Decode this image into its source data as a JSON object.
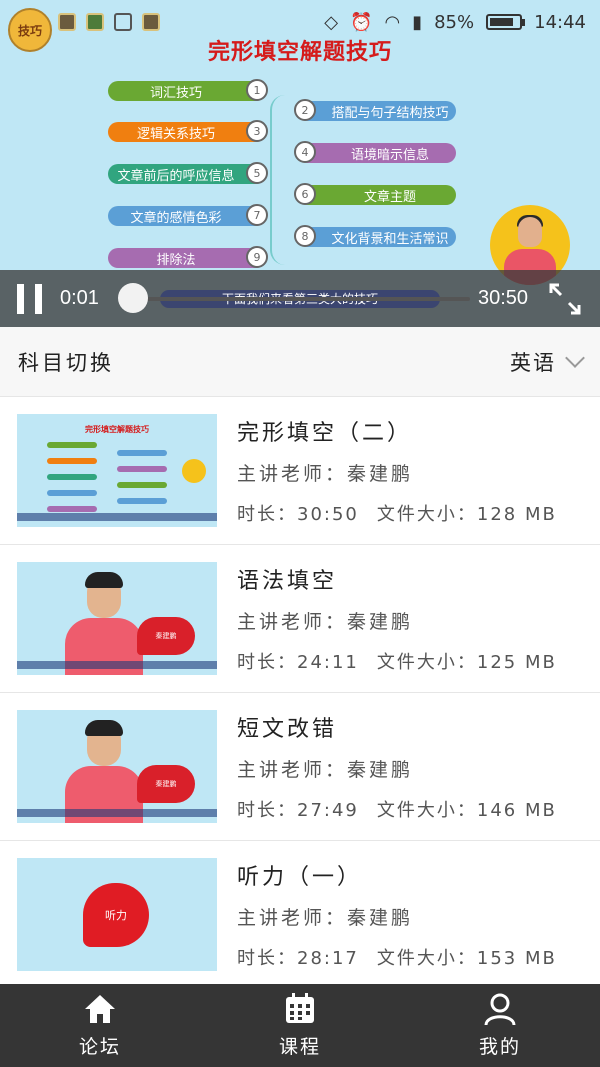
{
  "status_bar": {
    "battery": "85%",
    "battery_level": 0.85,
    "time": "14:44"
  },
  "video": {
    "slide_title": "完形填空解题技巧",
    "logo_text": "技巧",
    "mindmap": [
      {
        "num": "1",
        "label": "词汇技巧",
        "color": "#6aa833"
      },
      {
        "num": "2",
        "label": "搭配与句子结构技巧",
        "color": "#5b9fd6"
      },
      {
        "num": "3",
        "label": "逻辑关系技巧",
        "color": "#f07f10"
      },
      {
        "num": "4",
        "label": "语境暗示信息",
        "color": "#a66cb0"
      },
      {
        "num": "5",
        "label": "文章前后的呼应信息",
        "color": "#31a57f"
      },
      {
        "num": "6",
        "label": "文章主题",
        "color": "#6aa833"
      },
      {
        "num": "7",
        "label": "文章的感情色彩",
        "color": "#5b9fd6"
      },
      {
        "num": "8",
        "label": "文化背景和生活常识",
        "color": "#5b9fd6"
      },
      {
        "num": "9",
        "label": "排除法",
        "color": "#a66cb0"
      }
    ],
    "subtitle": "下面我们来看第三类大的技巧",
    "current_time": "0:01",
    "duration": "30:50",
    "progress": 0.001
  },
  "subject": {
    "label": "科目切换",
    "value": "英语"
  },
  "courses": [
    {
      "title": "完形填空（二）",
      "teacher": "主讲老师：秦建鹏",
      "duration_label": "时长：30:50",
      "size_label": "文件大小：128 MB",
      "thumb": "slide",
      "thumb_title": "完形填空解题技巧"
    },
    {
      "title": "语法填空",
      "teacher": "主讲老师：秦建鹏",
      "duration_label": "时长：24:11",
      "size_label": "文件大小：125 MB",
      "thumb": "teacher",
      "thumb_badge": "秦建鹏"
    },
    {
      "title": "短文改错",
      "teacher": "主讲老师：秦建鹏",
      "duration_label": "时长：27:49",
      "size_label": "文件大小：146 MB",
      "thumb": "teacher",
      "thumb_badge": "秦建鹏"
    },
    {
      "title": "听力（一）",
      "teacher": "主讲老师：秦建鹏",
      "duration_label": "时长：28:17",
      "size_label": "文件大小：153 MB",
      "thumb": "blob",
      "thumb_badge": "听力"
    }
  ],
  "nav": [
    {
      "label": "论坛",
      "icon": "home-icon"
    },
    {
      "label": "课程",
      "icon": "calendar-icon"
    },
    {
      "label": "我的",
      "icon": "user-icon"
    }
  ]
}
